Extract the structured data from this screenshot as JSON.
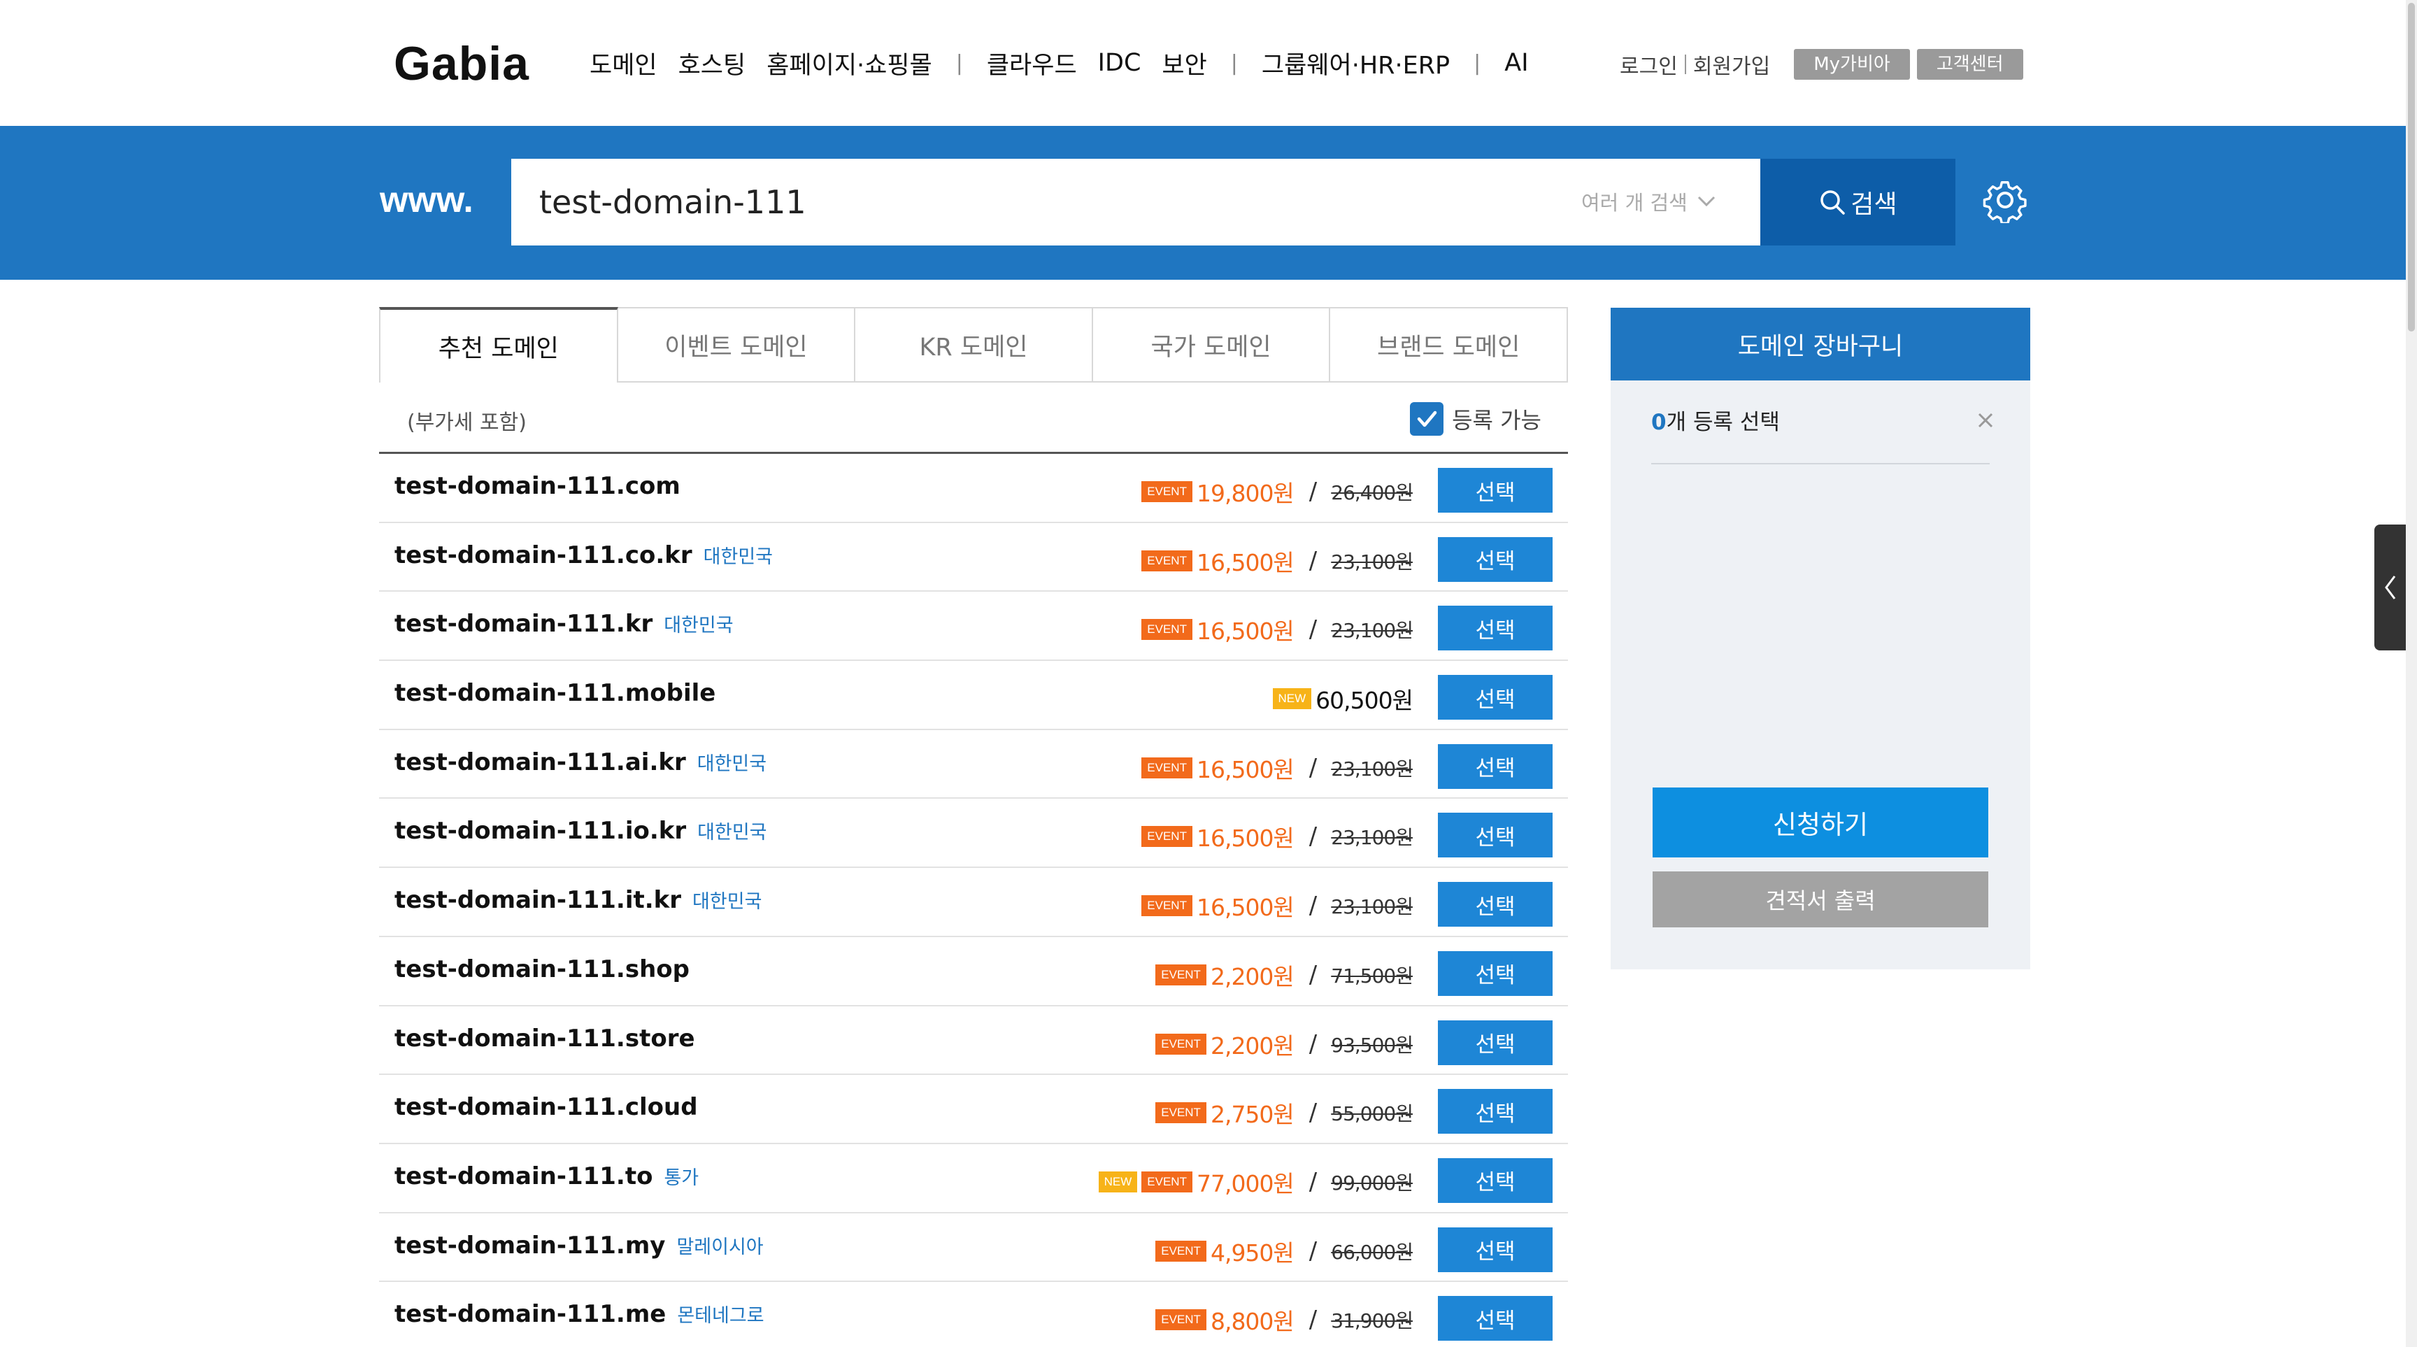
{
  "header": {
    "logo": "Gabia",
    "nav": [
      {
        "label": "도메인"
      },
      {
        "label": "호스팅"
      },
      {
        "label": "홈페이지·쇼핑몰"
      },
      {
        "label": "|",
        "sep": true
      },
      {
        "label": "클라우드"
      },
      {
        "label": "IDC"
      },
      {
        "label": "보안"
      },
      {
        "label": "|",
        "sep": true
      },
      {
        "label": "그룹웨어·HR·ERP"
      },
      {
        "label": "|",
        "sep": true
      },
      {
        "label": "AI"
      }
    ],
    "login": "로그인",
    "signup": "회원가입",
    "my_gabia": "My가비아",
    "customer_center": "고객센터"
  },
  "search": {
    "prefix": "www.",
    "value": "test-domain-111",
    "multi_label": "여러 개 검색",
    "button": "검색"
  },
  "tabs": [
    {
      "label": "추천 도메인",
      "active": true
    },
    {
      "label": "이벤트 도메인"
    },
    {
      "label": "KR 도메인"
    },
    {
      "label": "국가 도메인"
    },
    {
      "label": "브랜드 도메인"
    }
  ],
  "list_header": {
    "vat_note": "(부가세 포함)",
    "available_label": "등록 가능",
    "available_checked": true
  },
  "domains": [
    {
      "name": "test-domain-111.com",
      "country": "",
      "badges": [
        "EVENT"
      ],
      "price": "19,800원",
      "original": "26,400원"
    },
    {
      "name": "test-domain-111.co.kr",
      "country": "대한민국",
      "badges": [
        "EVENT"
      ],
      "price": "16,500원",
      "original": "23,100원"
    },
    {
      "name": "test-domain-111.kr",
      "country": "대한민국",
      "badges": [
        "EVENT"
      ],
      "price": "16,500원",
      "original": "23,100원"
    },
    {
      "name": "test-domain-111.mobile",
      "country": "",
      "badges": [
        "NEW"
      ],
      "price": "60,500원",
      "original": ""
    },
    {
      "name": "test-domain-111.ai.kr",
      "country": "대한민국",
      "badges": [
        "EVENT"
      ],
      "price": "16,500원",
      "original": "23,100원"
    },
    {
      "name": "test-domain-111.io.kr",
      "country": "대한민국",
      "badges": [
        "EVENT"
      ],
      "price": "16,500원",
      "original": "23,100원"
    },
    {
      "name": "test-domain-111.it.kr",
      "country": "대한민국",
      "badges": [
        "EVENT"
      ],
      "price": "16,500원",
      "original": "23,100원"
    },
    {
      "name": "test-domain-111.shop",
      "country": "",
      "badges": [
        "EVENT"
      ],
      "price": "2,200원",
      "original": "71,500원"
    },
    {
      "name": "test-domain-111.store",
      "country": "",
      "badges": [
        "EVENT"
      ],
      "price": "2,200원",
      "original": "93,500원"
    },
    {
      "name": "test-domain-111.cloud",
      "country": "",
      "badges": [
        "EVENT"
      ],
      "price": "2,750원",
      "original": "55,000원"
    },
    {
      "name": "test-domain-111.to",
      "country": "통가",
      "badges": [
        "NEW",
        "EVENT"
      ],
      "price": "77,000원",
      "original": "99,000원"
    },
    {
      "name": "test-domain-111.my",
      "country": "말레이시아",
      "badges": [
        "EVENT"
      ],
      "price": "4,950원",
      "original": "66,000원"
    },
    {
      "name": "test-domain-111.me",
      "country": "몬테네그로",
      "badges": [
        "EVENT"
      ],
      "price": "8,800원",
      "original": "31,900원"
    }
  ],
  "select_label": "선택",
  "cart": {
    "title": "도메인 장바구니",
    "count": "0",
    "count_suffix": "개 등록 선택",
    "apply": "신청하기",
    "quote": "견적서 출력"
  },
  "colors": {
    "brand_blue": "#1f76c1",
    "search_button": "#0d5da8",
    "event_orange": "#f26a1b",
    "new_yellow": "#f7b318",
    "select_button": "#1e86d6"
  }
}
